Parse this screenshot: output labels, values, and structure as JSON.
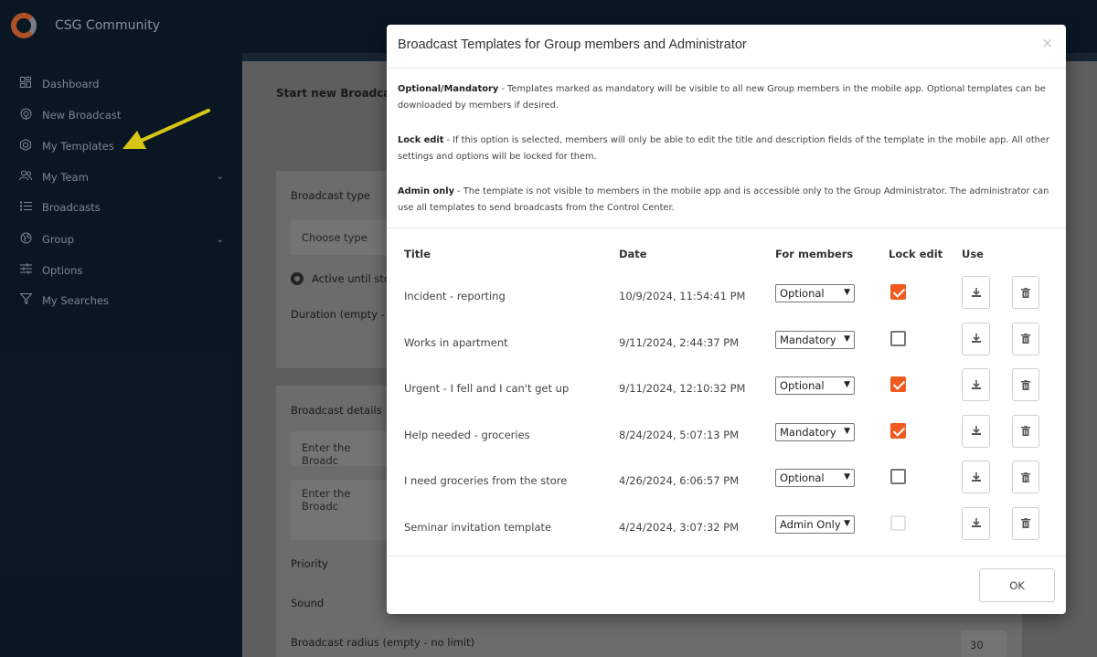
{
  "app": {
    "brand": "CSG Community"
  },
  "sidebar": {
    "items": [
      {
        "label": "Dashboard",
        "icon": "grid-icon"
      },
      {
        "label": "New Broadcast",
        "icon": "broadcast-icon"
      },
      {
        "label": "My Templates",
        "icon": "template-icon"
      },
      {
        "label": "My Team",
        "icon": "team-icon"
      },
      {
        "label": "Broadcasts",
        "icon": "list-icon"
      },
      {
        "label": "Group",
        "icon": "globe-icon"
      },
      {
        "label": "Options",
        "icon": "sliders-icon"
      },
      {
        "label": "My Searches",
        "icon": "funnel-icon"
      }
    ]
  },
  "background": {
    "start_title": "Start new Broadcas",
    "broadcast_type_label": "Broadcast type",
    "choose_type": "Choose type",
    "active_until": "Active until sto",
    "duration": "Duration (empty -",
    "details_label": "Broadcast details",
    "enter_1": "Enter the Broadc",
    "enter_2": "Enter the Broadc",
    "priority": "Priority",
    "sound": "Sound",
    "radius": "Broadcast radius (empty - no limit)",
    "radius_value": "30"
  },
  "modal": {
    "title": "Broadcast Templates for Group members and Administrator",
    "close": "×",
    "info": [
      {
        "term": "Optional/Mandatory",
        "text": " - Templates marked as mandatory will be visible to all new Group members in the mobile app. Optional templates can be downloaded by members if desired."
      },
      {
        "term": "Lock edit",
        "text": " - If this option is selected, members will only be able to edit the title and description fields of the template in the mobile app. All other settings and options will be locked for them."
      },
      {
        "term": "Admin only",
        "text": " - The template is not visible to members in the mobile app and is accessible only to the Group Administrator. The administrator can use all templates to send broadcasts from the Control Center."
      }
    ],
    "columns": {
      "title": "Title",
      "date": "Date",
      "for_members": "For members",
      "lock_edit": "Lock edit",
      "use": "Use"
    },
    "rows": [
      {
        "title": "Incident - reporting",
        "date": "10/9/2024, 11:54:41 PM",
        "members": "Optional",
        "lock": "checked"
      },
      {
        "title": "Works in apartment",
        "date": "9/11/2024, 2:44:37 PM",
        "members": "Mandatory",
        "lock": "unchecked"
      },
      {
        "title": "Urgent - I fell and I can't get up",
        "date": "9/11/2024, 12:10:32 PM",
        "members": "Optional",
        "lock": "checked"
      },
      {
        "title": "Help needed - groceries",
        "date": "8/24/2024, 5:07:13 PM",
        "members": "Mandatory",
        "lock": "checked"
      },
      {
        "title": "I need groceries from the store",
        "date": "4/26/2024, 6:06:57 PM",
        "members": "Optional",
        "lock": "unchecked"
      },
      {
        "title": "Seminar invitation template",
        "date": "4/24/2024, 3:07:32 PM",
        "members": "Admin Only",
        "lock": "disabled"
      }
    ],
    "ok_label": "OK"
  },
  "colors": {
    "accent": "#f05a1e",
    "sidebar_bg": "#0c1b28",
    "arrow": "#f5e11a"
  }
}
